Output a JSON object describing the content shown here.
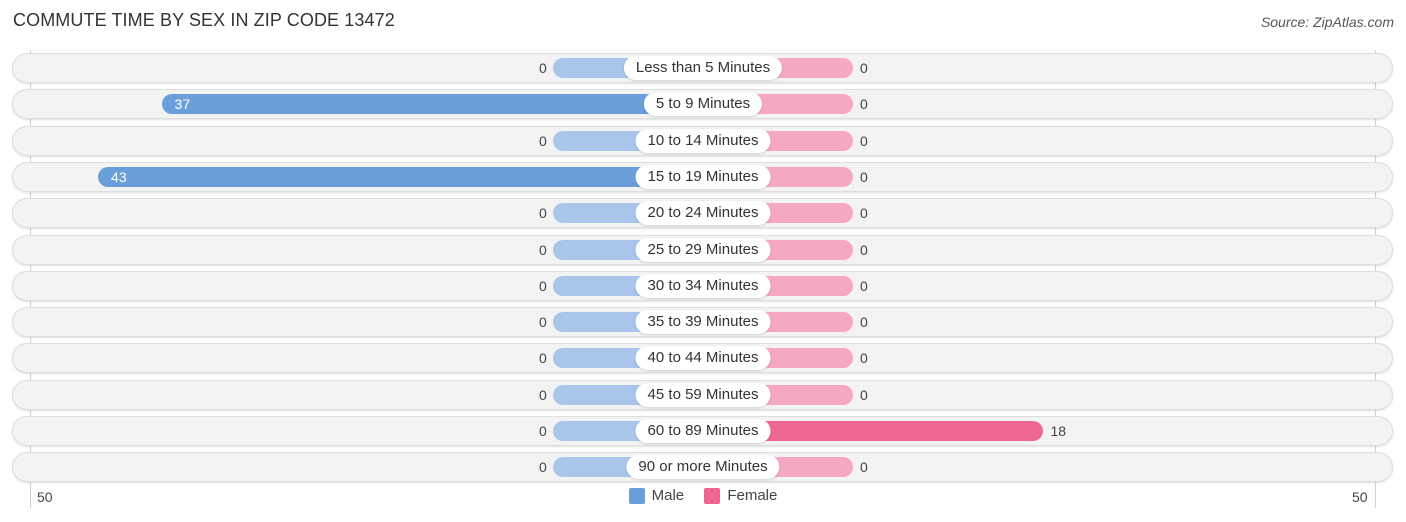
{
  "header": {
    "title": "COMMUTE TIME BY SEX IN ZIP CODE 13472",
    "source": "Source: ZipAtlas.com"
  },
  "colors": {
    "male": "#6a9fdc",
    "male_zero": "#a9c6ea",
    "female": "#f06892",
    "female_zero": "#f5a8c0"
  },
  "chart_data": {
    "type": "bar",
    "orientation": "horizontal-diverging",
    "title": "COMMUTE TIME BY SEX IN ZIP CODE 13472",
    "categories": [
      "Less than 5 Minutes",
      "5 to 9 Minutes",
      "10 to 14 Minutes",
      "15 to 19 Minutes",
      "20 to 24 Minutes",
      "25 to 29 Minutes",
      "30 to 34 Minutes",
      "35 to 39 Minutes",
      "40 to 44 Minutes",
      "45 to 59 Minutes",
      "60 to 89 Minutes",
      "90 or more Minutes"
    ],
    "series": [
      {
        "name": "Male",
        "values": [
          0,
          37,
          0,
          43,
          0,
          0,
          0,
          0,
          0,
          0,
          0,
          0
        ]
      },
      {
        "name": "Female",
        "values": [
          0,
          0,
          0,
          0,
          0,
          0,
          0,
          0,
          0,
          0,
          18,
          0
        ]
      }
    ],
    "axis": {
      "left_tick": "50",
      "right_tick": "50",
      "max": 50
    },
    "legend": {
      "position": "bottom-center",
      "entries": [
        "Male",
        "Female"
      ]
    },
    "grid": false
  }
}
